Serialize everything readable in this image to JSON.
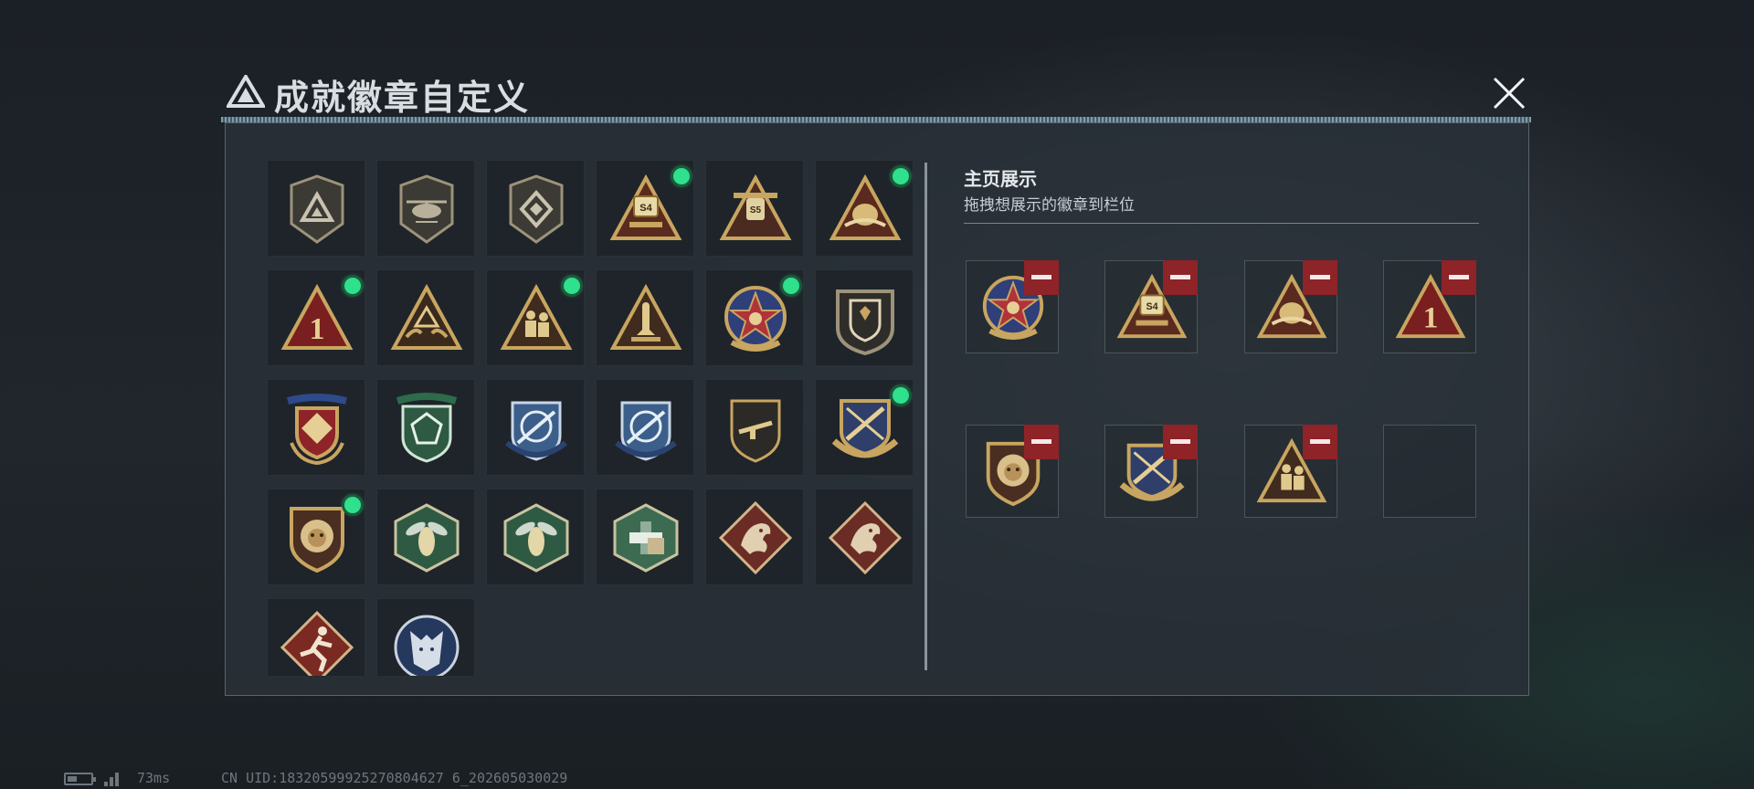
{
  "header": {
    "title": "成就徽章自定义",
    "close_icon": "close-icon"
  },
  "colors": {
    "gold": "#c8a560",
    "dark_gold": "#8a6a2e",
    "red": "#8e2328",
    "green_dot": "#2fe08c",
    "panel": "#2a3138"
  },
  "badges": [
    {
      "name": "delta-triangle-shield",
      "new": false
    },
    {
      "name": "helicopter-shield",
      "new": false
    },
    {
      "name": "diamond-shield",
      "new": false
    },
    {
      "name": "s4-triangle",
      "new": true
    },
    {
      "name": "s5-triangle",
      "new": false
    },
    {
      "name": "egg-triangle",
      "new": true
    },
    {
      "name": "number-one-triangle",
      "new": true
    },
    {
      "name": "hands-triangle",
      "new": false
    },
    {
      "name": "soldiers-triangle",
      "new": true
    },
    {
      "name": "rocket-triangle",
      "new": false
    },
    {
      "name": "star-compass-badge",
      "new": true
    },
    {
      "name": "crest-shield",
      "new": false
    },
    {
      "name": "laurel-crest-badge",
      "new": false
    },
    {
      "name": "green-gem-shield",
      "new": false
    },
    {
      "name": "sniper-blue-shield",
      "new": false
    },
    {
      "name": "sniper-blue-shield-2",
      "new": false
    },
    {
      "name": "rifle-shield",
      "new": false
    },
    {
      "name": "crossed-rifles-badge",
      "new": true
    },
    {
      "name": "lion-shield",
      "new": true
    },
    {
      "name": "wasp-hexagon",
      "new": false
    },
    {
      "name": "wasp-hexagon-2",
      "new": false
    },
    {
      "name": "medic-hexagon",
      "new": false
    },
    {
      "name": "dragon-diamond",
      "new": false
    },
    {
      "name": "dragon-diamond-2",
      "new": false
    },
    {
      "name": "runner-diamond",
      "new": false
    },
    {
      "name": "wolf-circle",
      "new": false
    }
  ],
  "display": {
    "title": "主页展示",
    "hint": "拖拽想展示的徽章到栏位",
    "slots": [
      {
        "badge": "star-compass-badge",
        "filled": true
      },
      {
        "badge": "s4-triangle",
        "filled": true
      },
      {
        "badge": "egg-triangle",
        "filled": true
      },
      {
        "badge": "number-one-triangle",
        "filled": true
      },
      {
        "badge": "lion-shield",
        "filled": true
      },
      {
        "badge": "crossed-rifles-badge",
        "filled": true
      },
      {
        "badge": "soldiers-triangle",
        "filled": true
      },
      {
        "badge": "",
        "filled": false
      }
    ]
  },
  "status": {
    "ping": "73ms",
    "uid": "CN UID:18320599925270804627 6_202605030029"
  }
}
